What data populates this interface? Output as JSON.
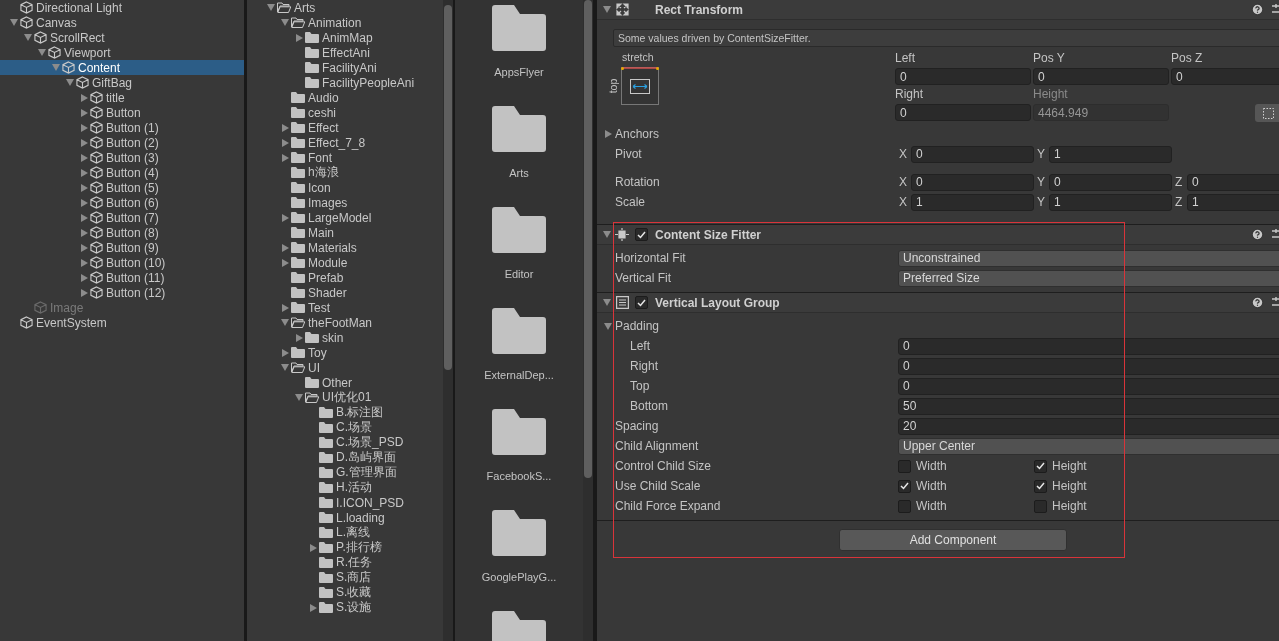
{
  "hierarchy": {
    "items": [
      {
        "name": "Directional Light",
        "selected": false,
        "inactive": false
      },
      {
        "name": "Canvas",
        "expanded": true,
        "selected": false,
        "inactive": false,
        "children": [
          {
            "name": "ScrollRect",
            "expanded": true,
            "selected": false,
            "inactive": false,
            "children": [
              {
                "name": "Viewport",
                "expanded": true,
                "selected": false,
                "inactive": false,
                "children": [
                  {
                    "name": "Content",
                    "expanded": true,
                    "selected": true,
                    "inactive": false,
                    "children": [
                      {
                        "name": "GiftBag",
                        "expanded": true,
                        "selected": false,
                        "inactive": false,
                        "children": [
                          {
                            "name": "title",
                            "expanded": false,
                            "selected": false,
                            "inactive": false
                          },
                          {
                            "name": "Button",
                            "expanded": false,
                            "selected": false,
                            "inactive": false
                          },
                          {
                            "name": "Button (1)",
                            "expanded": false,
                            "selected": false,
                            "inactive": false
                          },
                          {
                            "name": "Button (2)",
                            "expanded": false,
                            "selected": false,
                            "inactive": false
                          },
                          {
                            "name": "Button (3)",
                            "expanded": false,
                            "selected": false,
                            "inactive": false
                          },
                          {
                            "name": "Button (4)",
                            "expanded": false,
                            "selected": false,
                            "inactive": false
                          },
                          {
                            "name": "Button (5)",
                            "expanded": false,
                            "selected": false,
                            "inactive": false
                          },
                          {
                            "name": "Button (6)",
                            "expanded": false,
                            "selected": false,
                            "inactive": false
                          },
                          {
                            "name": "Button (7)",
                            "expanded": false,
                            "selected": false,
                            "inactive": false
                          },
                          {
                            "name": "Button (8)",
                            "expanded": false,
                            "selected": false,
                            "inactive": false
                          },
                          {
                            "name": "Button (9)",
                            "expanded": false,
                            "selected": false,
                            "inactive": false
                          },
                          {
                            "name": "Button (10)",
                            "expanded": false,
                            "selected": false,
                            "inactive": false
                          },
                          {
                            "name": "Button (11)",
                            "expanded": false,
                            "selected": false,
                            "inactive": false
                          },
                          {
                            "name": "Button (12)",
                            "expanded": false,
                            "selected": false,
                            "inactive": false
                          }
                        ]
                      }
                    ]
                  }
                ]
              }
            ]
          },
          {
            "name": "Image",
            "selected": false,
            "inactive": true
          }
        ]
      },
      {
        "name": "EventSystem",
        "selected": false,
        "inactive": false
      }
    ]
  },
  "project_tree": {
    "items": [
      {
        "name": "Arts",
        "expanded": true,
        "children": [
          {
            "name": "Animation",
            "expanded": true,
            "children": [
              {
                "name": "AnimMap",
                "expanded": false
              },
              {
                "name": "EffectAni"
              },
              {
                "name": "FacilityAni"
              },
              {
                "name": "FacilityPeopleAni"
              }
            ]
          },
          {
            "name": "Audio"
          },
          {
            "name": "ceshi"
          },
          {
            "name": "Effect",
            "expanded": false
          },
          {
            "name": "Effect_7_8",
            "expanded": false
          },
          {
            "name": "Font",
            "expanded": false
          },
          {
            "name": "h海浪"
          },
          {
            "name": "Icon"
          },
          {
            "name": "Images"
          },
          {
            "name": "LargeModel",
            "expanded": false
          },
          {
            "name": "Main"
          },
          {
            "name": "Materials",
            "expanded": false
          },
          {
            "name": "Module",
            "expanded": false
          },
          {
            "name": "Prefab"
          },
          {
            "name": "Shader"
          },
          {
            "name": "Test",
            "expanded": false
          },
          {
            "name": "theFootMan",
            "expanded": true,
            "children": [
              {
                "name": "skin",
                "expanded": false
              }
            ]
          },
          {
            "name": "Toy",
            "expanded": false
          },
          {
            "name": "UI",
            "expanded": true,
            "children": [
              {
                "name": "Other"
              },
              {
                "name": "UI优化01",
                "expanded": true,
                "children": [
                  {
                    "name": "B.标注图"
                  },
                  {
                    "name": "C.场景"
                  },
                  {
                    "name": "C.场景_PSD"
                  },
                  {
                    "name": "D.岛屿界面"
                  },
                  {
                    "name": "G.管理界面"
                  },
                  {
                    "name": "H.活动"
                  },
                  {
                    "name": "I.ICON_PSD"
                  },
                  {
                    "name": "L.loading"
                  },
                  {
                    "name": "L.离线"
                  },
                  {
                    "name": "P.排行榜",
                    "expanded": false
                  },
                  {
                    "name": "R.任务"
                  },
                  {
                    "name": "S.商店"
                  },
                  {
                    "name": "S.收藏"
                  },
                  {
                    "name": "S.设施",
                    "expanded": false
                  }
                ]
              }
            ]
          }
        ]
      }
    ]
  },
  "project_grid": {
    "folders": [
      "AppsFlyer",
      "Arts",
      "Editor",
      "ExternalDep...",
      "FacebookS...",
      "GooglePlayG..."
    ]
  },
  "inspector": {
    "components": [
      {
        "kind": "rect_transform",
        "title": "Rect Transform",
        "expanded": true,
        "note": "Some values driven by ContentSizeFitter.",
        "anchor_preset": {
          "horizontal": "stretch",
          "vertical": "top"
        },
        "field_rows": [
          [
            {
              "label": "Left",
              "value": "0",
              "disabled": false
            },
            {
              "label": "Pos Y",
              "value": "0",
              "disabled": false
            },
            {
              "label": "Pos Z",
              "value": "0",
              "disabled": false
            }
          ],
          [
            {
              "label": "Right",
              "value": "0",
              "disabled": false
            },
            {
              "label": "Height",
              "value": "4464.949",
              "disabled": true
            }
          ]
        ],
        "anchors": {
          "label": "Anchors",
          "expanded": false
        },
        "vector_groups": [
          [
            {
              "label": "Pivot",
              "axes": [
                {
                  "axis": "X",
                  "value": "0"
                },
                {
                  "axis": "Y",
                  "value": "1"
                }
              ]
            }
          ],
          [
            {
              "label": "Rotation",
              "axes": [
                {
                  "axis": "X",
                  "value": "0"
                },
                {
                  "axis": "Y",
                  "value": "0"
                },
                {
                  "axis": "Z",
                  "value": "0"
                }
              ]
            },
            {
              "label": "Scale",
              "axes": [
                {
                  "axis": "X",
                  "value": "1"
                },
                {
                  "axis": "Y",
                  "value": "1"
                },
                {
                  "axis": "Z",
                  "value": "1"
                }
              ]
            }
          ]
        ]
      },
      {
        "kind": "content_size_fitter",
        "title": "Content Size Fitter",
        "enabled": true,
        "expanded": true,
        "rows": [
          {
            "kind": "dropdown",
            "label": "Horizontal Fit",
            "value": "Unconstrained"
          },
          {
            "kind": "dropdown",
            "label": "Vertical Fit",
            "value": "Preferred Size"
          }
        ]
      },
      {
        "kind": "layout_group",
        "title": "Vertical Layout Group",
        "enabled": true,
        "expanded": true,
        "rows": [
          {
            "kind": "foldout",
            "label": "Padding",
            "expanded": true,
            "children": [
              {
                "kind": "number",
                "label": "Left",
                "value": "0"
              },
              {
                "kind": "number",
                "label": "Right",
                "value": "0"
              },
              {
                "kind": "number",
                "label": "Top",
                "value": "0"
              },
              {
                "kind": "number",
                "label": "Bottom",
                "value": "50"
              }
            ]
          },
          {
            "kind": "number",
            "label": "Spacing",
            "value": "20"
          },
          {
            "kind": "dropdown",
            "label": "Child Alignment",
            "value": "Upper Center"
          },
          {
            "kind": "toggles",
            "label": "Control Child Size",
            "options": [
              {
                "label": "Width",
                "checked": false
              },
              {
                "label": "Height",
                "checked": true
              }
            ]
          },
          {
            "kind": "toggles",
            "label": "Use Child Scale",
            "options": [
              {
                "label": "Width",
                "checked": true
              },
              {
                "label": "Height",
                "checked": true
              }
            ]
          },
          {
            "kind": "toggles",
            "label": "Child Force Expand",
            "options": [
              {
                "label": "Width",
                "checked": false
              },
              {
                "label": "Height",
                "checked": false
              }
            ]
          }
        ]
      }
    ],
    "add_button": "Add Component"
  }
}
